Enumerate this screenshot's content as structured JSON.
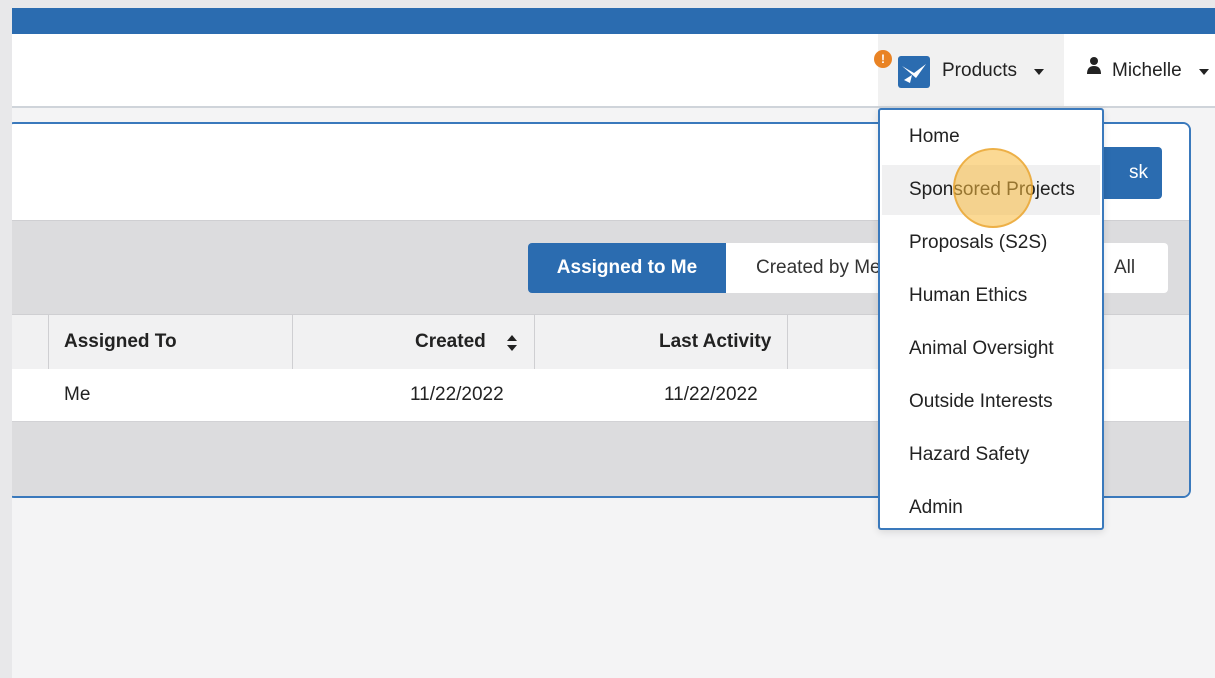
{
  "header": {
    "info_badge": "!",
    "products_label": "Products",
    "user_label": "Michelle",
    "icons": [
      "info-icon",
      "app-logo-icon",
      "chevron-down-icon",
      "user-icon"
    ],
    "colors": {
      "brand": "#2b6cb0",
      "badge": "#e98324"
    }
  },
  "toolbar": {
    "new_task_label": "sk"
  },
  "filters": {
    "tabs": [
      {
        "label": "Assigned to Me",
        "active": true
      },
      {
        "label": "Created by Me",
        "active": false
      },
      {
        "label": "All",
        "active": false
      }
    ]
  },
  "table": {
    "columns": [
      {
        "label": "Assigned To"
      },
      {
        "label": "Created",
        "sortable": true
      },
      {
        "label": "Last Activity"
      }
    ],
    "rows": [
      {
        "assigned_to": "Me",
        "created": "11/22/2022",
        "last_activity": "11/22/2022"
      }
    ]
  },
  "products_menu": {
    "items": [
      {
        "label": "Home"
      },
      {
        "label": "Sponsored Projects",
        "hovered": true
      },
      {
        "label": "Proposals (S2S)"
      },
      {
        "label": "Human Ethics"
      },
      {
        "label": "Animal Oversight"
      },
      {
        "label": "Outside Interests"
      },
      {
        "label": "Hazard Safety"
      },
      {
        "label": "Admin"
      }
    ]
  }
}
